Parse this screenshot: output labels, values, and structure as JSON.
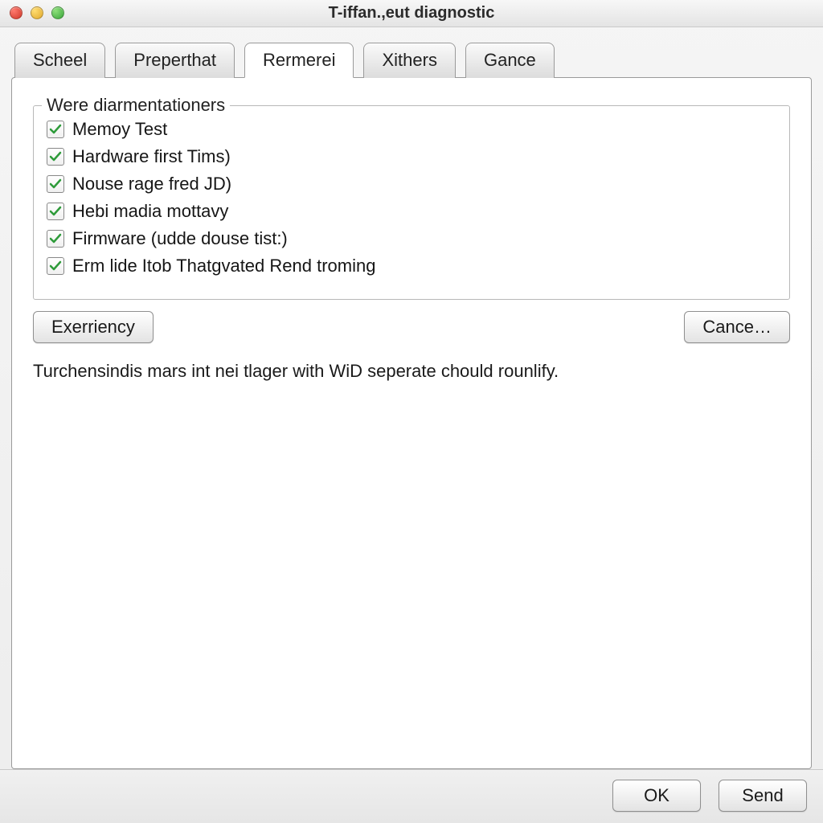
{
  "window": {
    "title": "T-iffan.,eut diagnostic"
  },
  "tabs": [
    {
      "label": "Scheel",
      "active": false
    },
    {
      "label": "Preperthat",
      "active": false
    },
    {
      "label": "Rermerei",
      "active": true
    },
    {
      "label": "Xithers",
      "active": false
    },
    {
      "label": "Gance",
      "active": false
    }
  ],
  "group": {
    "title": "Were diarmentationers",
    "items": [
      {
        "label": "Memoy Test",
        "checked": true
      },
      {
        "label": "Hardware first Tims)",
        "checked": true
      },
      {
        "label": "Nouse rage fred JD)",
        "checked": true
      },
      {
        "label": "Hebi madia mottavy",
        "checked": true
      },
      {
        "label": "Firmware (udde douse tist:)",
        "checked": true
      },
      {
        "label": "Erm lide Itob Thatgvated Rend troming",
        "checked": true
      }
    ]
  },
  "buttons": {
    "left": "Exerriency",
    "right": "Cance…"
  },
  "info": "Turchensindis mars int nei tlager with WiD seperate chould rounlify.",
  "footer": {
    "ok": "OK",
    "send": "Send"
  }
}
